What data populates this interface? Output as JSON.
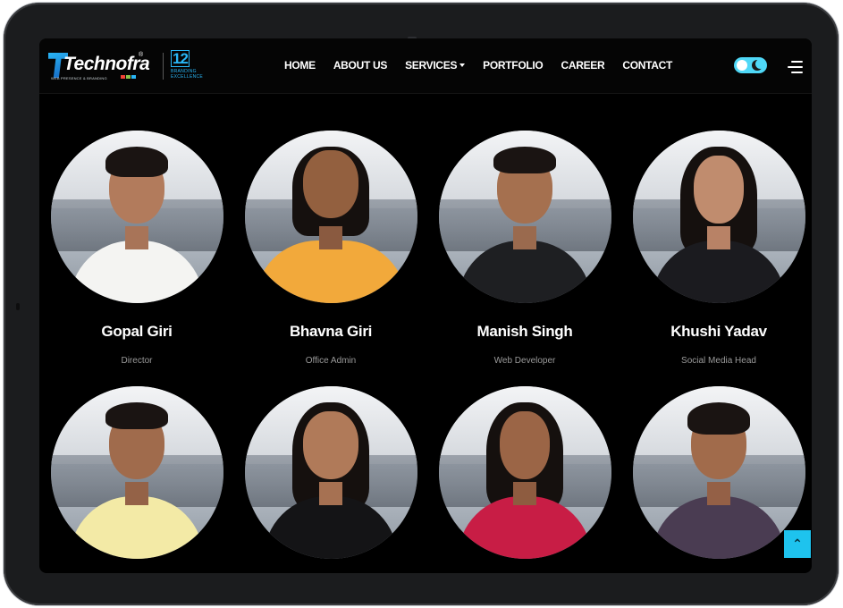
{
  "brand": {
    "name": "Technofra",
    "registered": "®",
    "tagline": "WEB PRESENCE & BRANDING",
    "badge_number": "12",
    "badge_text": "BRANDING EXCELLENCE",
    "accent": "#29b6f6"
  },
  "nav": {
    "items": [
      {
        "label": "HOME",
        "has_dropdown": false
      },
      {
        "label": "ABOUT US",
        "has_dropdown": false
      },
      {
        "label": "SERVICES",
        "has_dropdown": true
      },
      {
        "label": "PORTFOLIO",
        "has_dropdown": false
      },
      {
        "label": "CAREER",
        "has_dropdown": false
      },
      {
        "label": "CONTACT",
        "has_dropdown": false
      }
    ],
    "theme_toggle_icon": "moon-icon",
    "menu_icon": "hamburger-icon"
  },
  "team": [
    {
      "name": "Gopal Giri",
      "role": "Director"
    },
    {
      "name": "Bhavna Giri",
      "role": "Office Admin"
    },
    {
      "name": "Manish Singh",
      "role": "Web Developer"
    },
    {
      "name": "Khushi Yadav",
      "role": "Social Media Head"
    },
    {
      "name": "",
      "role": ""
    },
    {
      "name": "",
      "role": ""
    },
    {
      "name": "",
      "role": ""
    },
    {
      "name": "",
      "role": ""
    }
  ],
  "scroll_top_icon": "double-chevron-up-icon",
  "colors": {
    "background": "#000000",
    "toggle": "#4fd8f7",
    "scroll_button": "#1ec3ee",
    "role_text": "#9a9a9a"
  }
}
